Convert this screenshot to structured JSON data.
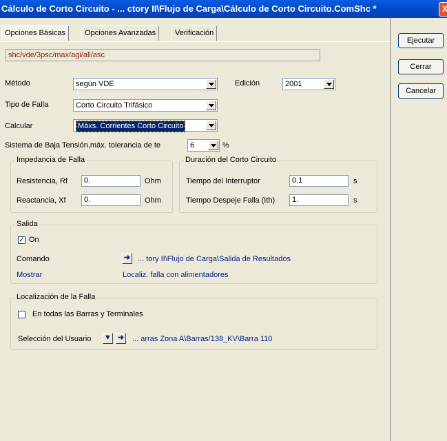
{
  "window": {
    "title": "Cálculo de Corto Circuito - ... ctory II\\Flujo de Carga\\Cálculo de Corto Circuito.ComShc *",
    "close_glyph": "X"
  },
  "tabs": [
    {
      "label": "Opciones Básicas"
    },
    {
      "label": "Opciones Avanzadas"
    },
    {
      "label": "Verificación"
    }
  ],
  "path": "shc/vde/3psc/max/agi/all/asc",
  "buttons": {
    "run": "Ejecutar",
    "close": "Cerrar",
    "cancel": "Cancelar"
  },
  "form": {
    "method_label": "Método",
    "method_value": "según VDE",
    "edition_label": "Edición",
    "edition_value": "2001",
    "fault_type_label": "Tipo de Falla",
    "fault_type_value": "Corto Circuito Trifásico",
    "calc_label": "Calcular",
    "calc_value": "Máxs. Corrientes Corto Circuito",
    "lv_label": "Sistema de Baja Tensión,máx. tolerancia de te",
    "lv_value": "6",
    "lv_unit": "%"
  },
  "impedance": {
    "title": "Impedancia de Falla",
    "resistance_label": "Resistencia, Rf",
    "resistance_value": "0.",
    "resistance_unit": "Ohm",
    "reactance_label": "Reactancia, Xf",
    "reactance_value": "0.",
    "reactance_unit": "Ohm"
  },
  "duration": {
    "title": "Duración del Corto Circuito",
    "breaker_label": "Tiempo del Interruptor",
    "breaker_value": "0.1",
    "breaker_unit": "s",
    "clear_label": "Tiempo Despeje Falla (Ith)",
    "clear_value": "1.",
    "clear_unit": "s"
  },
  "output": {
    "title": "Salida",
    "on_label": "On",
    "on_checked": true,
    "command_label": "Comando",
    "command_value": "... tory II\\Flujo de Carga\\Salida de Resultados",
    "show_label": "Mostrar",
    "show_value": "Localiz. falla con alimentadores"
  },
  "location": {
    "title": "Localización de la Falla",
    "all_label": "En todas las Barras y Terminales",
    "all_checked": false,
    "user_label": "Selección del Usuario",
    "user_value": "... arras Zona A\\Barras/138_KV\\Barra 110"
  }
}
